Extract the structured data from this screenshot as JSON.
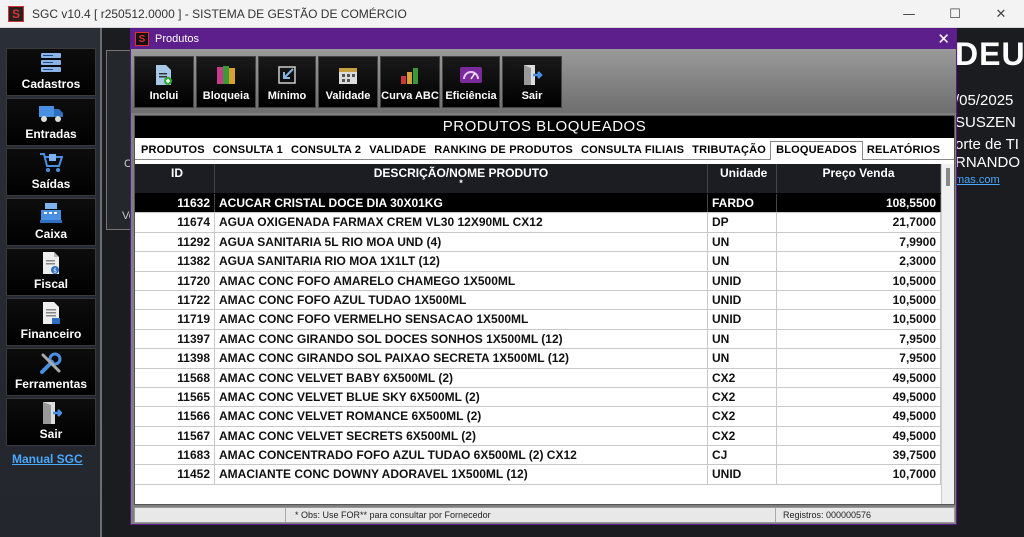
{
  "main_window": {
    "app_badge": "S",
    "title": "SGC v10.4 [ r250512.0000 ] - SISTEMA DE GESTÃO DE COMÉRCIO",
    "controls": {
      "minimize": "—",
      "maximize": "☐",
      "close": "✕"
    }
  },
  "sidebar": {
    "items": [
      {
        "label": "Cadastros",
        "icon": "server-stack-icon"
      },
      {
        "label": "Entradas",
        "icon": "truck-icon"
      },
      {
        "label": "Saídas",
        "icon": "cart-icon"
      },
      {
        "label": "Caixa",
        "icon": "cash-register-icon"
      },
      {
        "label": "Fiscal",
        "icon": "document-dollar-icon"
      },
      {
        "label": "Financeiro",
        "icon": "receipt-icon"
      },
      {
        "label": "Ferramentas",
        "icon": "tools-icon"
      },
      {
        "label": "Sair",
        "icon": "exit-door-icon"
      }
    ],
    "manual_link": "Manual SGC"
  },
  "background": {
    "big_text": "DEU",
    "line1": "/05/2025",
    "line2": "SUSZEN",
    "line3": "orte de TI",
    "line4": "RNANDO",
    "link": "mas.com",
    "letters": [
      "I",
      "C",
      "Ve"
    ]
  },
  "dialog": {
    "badge": "S",
    "title": "Produtos",
    "close": "✕",
    "toolbar": [
      {
        "label": "Inclui",
        "icon": "add-document-icon"
      },
      {
        "label": "Bloqueia",
        "icon": "block-books-icon"
      },
      {
        "label": "Mínimo",
        "icon": "minimum-arrow-icon"
      },
      {
        "label": "Validade",
        "icon": "calendar-icon"
      },
      {
        "label": "Curva ABC",
        "icon": "abc-curve-icon"
      },
      {
        "label": "Eficiência",
        "icon": "efficiency-gauge-icon"
      },
      {
        "label": "Sair",
        "icon": "exit-door-icon"
      }
    ],
    "section_title": "PRODUTOS BLOQUEADOS",
    "tabs": [
      "PRODUTOS",
      "CONSULTA 1",
      "CONSULTA 2",
      "VALIDADE",
      "RANKING DE PRODUTOS",
      "CONSULTA FILIAIS",
      "TRIBUTAÇÃO",
      "BLOQUEADOS",
      "RELATÓRIOS"
    ],
    "active_tab": "BLOQUEADOS",
    "grid": {
      "columns": [
        "ID",
        "DESCRIÇÃO/NOME PRODUTO",
        "Unidade",
        "Preço Venda"
      ],
      "sort_indicator": "*",
      "rows": [
        {
          "id": "11632",
          "desc": "ACUCAR CRISTAL DOCE DIA 30X01KG",
          "un": "FARDO",
          "price": "108,5500"
        },
        {
          "id": "11674",
          "desc": "AGUA OXIGENADA FARMAX CREM VL30 12X90ML  CX12",
          "un": "DP",
          "price": "21,7000"
        },
        {
          "id": "11292",
          "desc": "AGUA SANITARIA 5L RIO MOA UND (4)",
          "un": "UN",
          "price": "7,9900"
        },
        {
          "id": "11382",
          "desc": "AGUA SANITARIA RIO MOA 1X1LT (12)",
          "un": "UN",
          "price": "2,3000"
        },
        {
          "id": "11720",
          "desc": "AMAC CONC FOFO AMARELO CHAMEGO  1X500ML",
          "un": "UNID",
          "price": "10,5000"
        },
        {
          "id": "11722",
          "desc": "AMAC CONC FOFO AZUL TUDAO 1X500ML",
          "un": "UNID",
          "price": "10,5000"
        },
        {
          "id": "11719",
          "desc": "AMAC CONC FOFO VERMELHO SENSACAO 1X500ML",
          "un": "UNID",
          "price": "10,5000"
        },
        {
          "id": "11397",
          "desc": "AMAC CONC GIRANDO SOL DOCES SONHOS 1X500ML (12)",
          "un": "UN",
          "price": "7,9500"
        },
        {
          "id": "11398",
          "desc": "AMAC CONC GIRANDO SOL PAIXAO SECRETA 1X500ML (12)",
          "un": "UN",
          "price": "7,9500"
        },
        {
          "id": "11568",
          "desc": "AMAC CONC VELVET BABY  6X500ML (2)",
          "un": "CX2",
          "price": "49,5000"
        },
        {
          "id": "11565",
          "desc": "AMAC CONC VELVET BLUE SKY  6X500ML (2)",
          "un": "CX2",
          "price": "49,5000"
        },
        {
          "id": "11566",
          "desc": "AMAC CONC VELVET ROMANCE  6X500ML (2)",
          "un": "CX2",
          "price": "49,5000"
        },
        {
          "id": "11567",
          "desc": "AMAC CONC VELVET SECRETS  6X500ML (2)",
          "un": "CX2",
          "price": "49,5000"
        },
        {
          "id": "11683",
          "desc": "AMAC CONCENTRADO FOFO AZUL TUDAO  6X500ML  (2) CX12",
          "un": "CJ",
          "price": "39,7500"
        },
        {
          "id": "11452",
          "desc": "AMACIANTE CONC DOWNY ADORAVEL 1X500ML (12)",
          "un": "UNID",
          "price": "10,7000"
        }
      ],
      "selected_index": 0
    },
    "status": {
      "note": "* Obs: Use FOR** para consultar por Fornecedor",
      "records": "Registros: 000000576"
    }
  }
}
